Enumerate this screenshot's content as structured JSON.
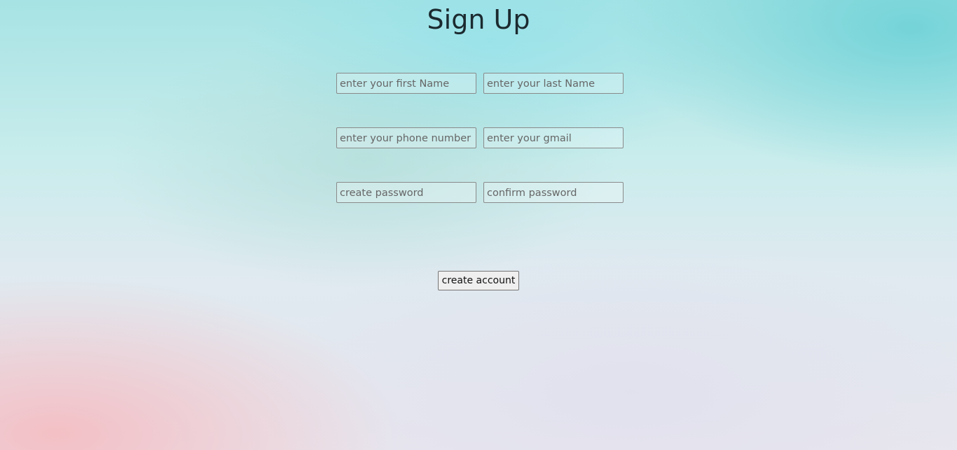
{
  "page": {
    "title": "Sign Up"
  },
  "form": {
    "first_name": {
      "placeholder": "enter your first Name",
      "value": ""
    },
    "last_name": {
      "placeholder": "enter your last Name",
      "value": ""
    },
    "phone": {
      "placeholder": "enter your phone number",
      "value": ""
    },
    "gmail": {
      "placeholder": "enter your gmail",
      "value": ""
    },
    "password": {
      "placeholder": "create password",
      "value": ""
    },
    "confirm_password": {
      "placeholder": "confirm password",
      "value": ""
    },
    "submit_label": "create account"
  },
  "colors": {
    "background_top": "#a7e3e4",
    "background_bottom_left": "#f5b9be",
    "title_text": "#1b2a2f"
  }
}
